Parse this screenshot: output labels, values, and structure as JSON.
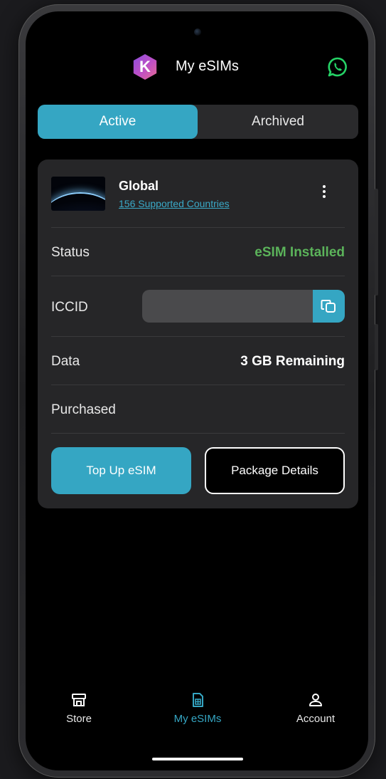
{
  "header": {
    "title": "My eSIMs",
    "logo_letter": "K"
  },
  "tabs": [
    {
      "label": "Active",
      "selected": true
    },
    {
      "label": "Archived",
      "selected": false
    }
  ],
  "esim_card": {
    "plan_name": "Global",
    "supported_link": "156 Supported Countries",
    "rows": {
      "status": {
        "label": "Status",
        "value": "eSIM Installed"
      },
      "iccid": {
        "label": "ICCID",
        "value": ""
      },
      "data": {
        "label": "Data",
        "value": "3 GB Remaining"
      },
      "purchased": {
        "label": "Purchased",
        "value": ""
      }
    },
    "buttons": {
      "top_up": "Top Up eSIM",
      "package_details": "Package Details"
    }
  },
  "bottom_nav": [
    {
      "label": "Store",
      "icon": "store-icon",
      "active": false
    },
    {
      "label": "My eSIMs",
      "icon": "sim-card-icon",
      "active": true
    },
    {
      "label": "Account",
      "icon": "person-icon",
      "active": false
    }
  ],
  "colors": {
    "accent": "#35a6c3",
    "status_green": "#5bb35a",
    "whatsapp_green": "#25d366",
    "background": "#000000",
    "card": "#262628"
  }
}
